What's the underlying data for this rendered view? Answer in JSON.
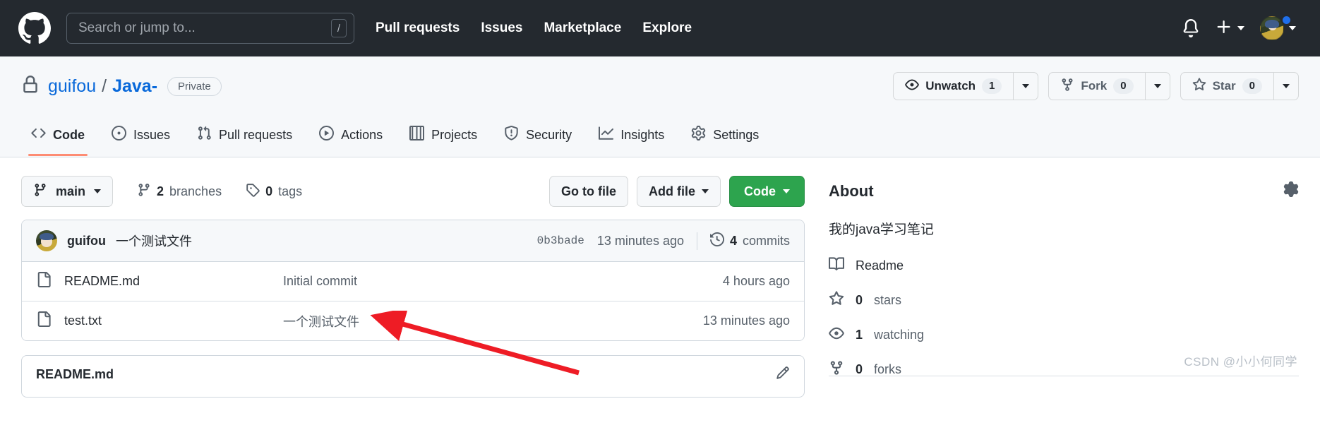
{
  "header": {
    "logo_icon": "github-mark-icon",
    "search": {
      "placeholder": "Search or jump to...",
      "shortcut": "/"
    },
    "nav": [
      {
        "label": "Pull requests"
      },
      {
        "label": "Issues"
      },
      {
        "label": "Marketplace"
      },
      {
        "label": "Explore"
      }
    ],
    "notifications_icon": "bell-icon",
    "create_new_icon": "plus-icon",
    "avatar_icon": "user-avatar",
    "has_notification_dot": true
  },
  "repo": {
    "visibility_icon": "lock-icon",
    "owner": "guifou",
    "separator": "/",
    "name": "Java-",
    "visibility_label": "Private",
    "actions": {
      "watch_label": "Unwatch",
      "watch_count": "1",
      "watch_icon": "eye-icon",
      "fork_label": "Fork",
      "fork_count": "0",
      "fork_icon": "repo-forked-icon",
      "star_label": "Star",
      "star_count": "0",
      "star_icon": "star-icon"
    },
    "tabs": [
      {
        "label": "Code",
        "icon": "code-icon",
        "active": true
      },
      {
        "label": "Issues",
        "icon": "issue-opened-icon",
        "active": false
      },
      {
        "label": "Pull requests",
        "icon": "git-pull-request-icon",
        "active": false
      },
      {
        "label": "Actions",
        "icon": "play-icon",
        "active": false
      },
      {
        "label": "Projects",
        "icon": "table-icon",
        "active": false
      },
      {
        "label": "Security",
        "icon": "shield-icon",
        "active": false
      },
      {
        "label": "Insights",
        "icon": "graph-icon",
        "active": false
      },
      {
        "label": "Settings",
        "icon": "gear-icon",
        "active": false
      }
    ]
  },
  "toolbar": {
    "branch_icon": "git-branch-icon",
    "branch_name": "main",
    "branches_count": "2",
    "branches_label": "branches",
    "tags_icon": "tag-icon",
    "tags_count": "0",
    "tags_label": "tags",
    "go_to_file_label": "Go to file",
    "add_file_label": "Add file",
    "code_label": "Code",
    "code_button_color": "#2da44e"
  },
  "latest_commit": {
    "avatar_icon": "user-avatar",
    "author": "guifou",
    "message": "一个测试文件",
    "sha": "0b3bade",
    "time": "13 minutes ago",
    "commits_icon": "history-icon",
    "commits_count": "4",
    "commits_label": "commits"
  },
  "files": {
    "columns": [
      "name",
      "message",
      "time"
    ],
    "rows": [
      {
        "icon": "file-icon",
        "name": "README.md",
        "message": "Initial commit",
        "time": "4 hours ago"
      },
      {
        "icon": "file-icon",
        "name": "test.txt",
        "message": "一个测试文件",
        "time": "13 minutes ago"
      }
    ]
  },
  "readme": {
    "title": "README.md",
    "edit_icon": "pencil-icon"
  },
  "about": {
    "title": "About",
    "settings_icon": "gear-icon",
    "description": "我的java学习笔记",
    "items": [
      {
        "icon": "book-icon",
        "label": "Readme",
        "value": ""
      },
      {
        "icon": "star-icon",
        "label": "stars",
        "value": "0"
      },
      {
        "icon": "eye-icon",
        "label": "watching",
        "value": "1"
      },
      {
        "icon": "repo-forked-icon",
        "label": "forks",
        "value": "0"
      }
    ]
  },
  "annotation": {
    "arrow_color": "#ee1c25",
    "points_to": "一个测试文件"
  },
  "watermark": {
    "text": "CSDN @小小何同学"
  }
}
